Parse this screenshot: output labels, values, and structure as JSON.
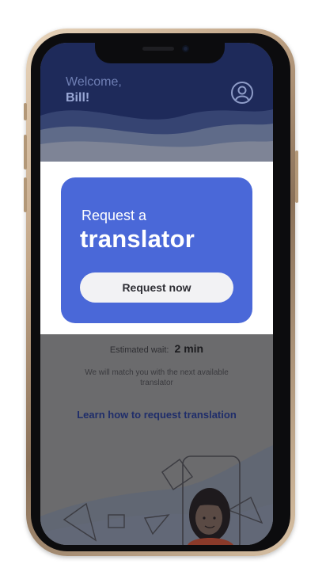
{
  "header": {
    "welcome": "Welcome,",
    "name": "Bill!"
  },
  "card": {
    "pre_title": "Request a",
    "title": "translator",
    "button_label": "Request now"
  },
  "wait": {
    "label": "Estimated wait:",
    "value": "2 min"
  },
  "match_text": "We will match you with the next available translator",
  "learn_link": "Learn how to request translation",
  "icons": [
    "profile-icon",
    "phone-illustration"
  ],
  "colors": {
    "header": "#1e2a5a",
    "card": "#4a68d8",
    "button": "#f2f2f4",
    "link": "#1f2d6a",
    "overlay": "#6b6b6d"
  }
}
